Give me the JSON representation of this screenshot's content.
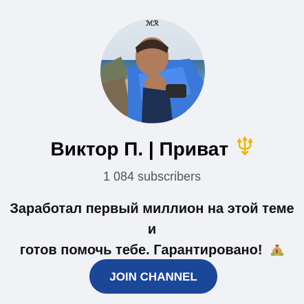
{
  "channel": {
    "name": "Виктор П. | Приват",
    "subscribers": "1 084 subscribers",
    "description_line1": "Заработал первый миллион на этой теме и",
    "description_line2": "готов помочь тебе. Гарантировано!",
    "join_label": "JOIN CHANNEL"
  },
  "colors": {
    "background": "#f1f2f6",
    "button": "#1b4799",
    "trident": "#f2b400"
  },
  "icons": {
    "name_badge": "trident-icon",
    "description_emoji": "money-bag-emoji"
  }
}
